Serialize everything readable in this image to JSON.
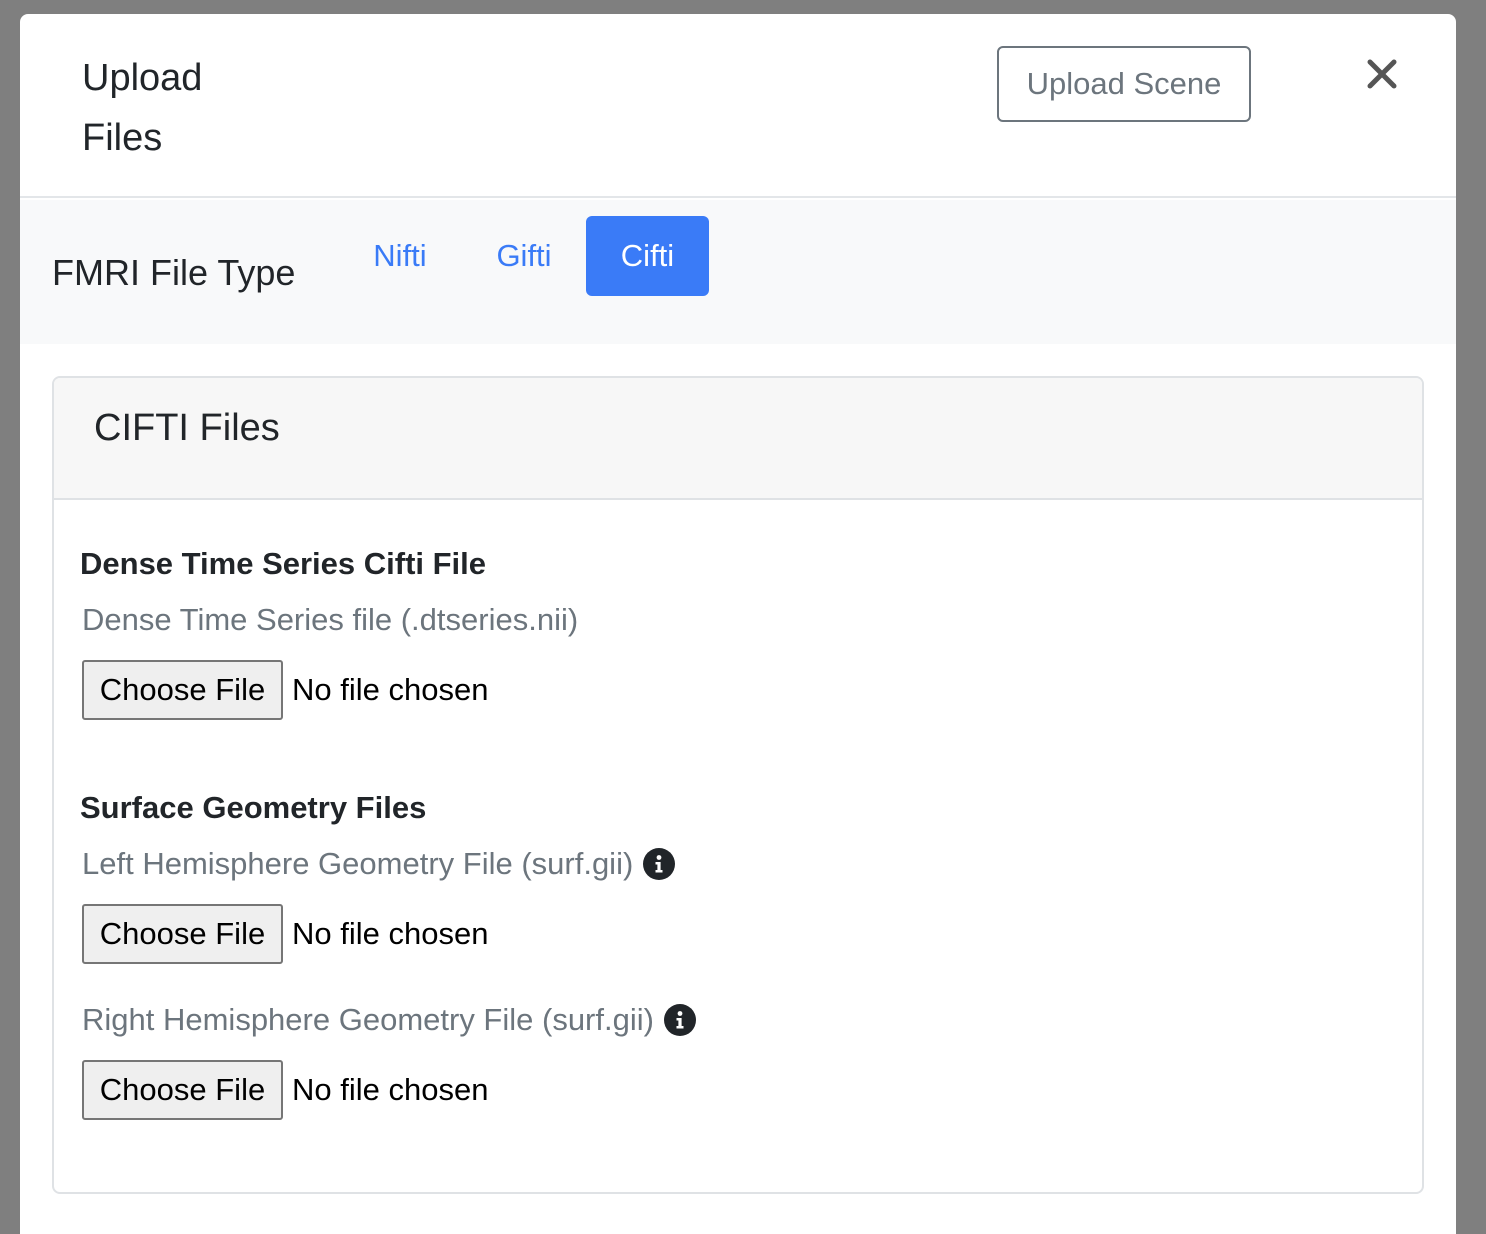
{
  "modal": {
    "title": "Upload Files",
    "upload_scene_label": "Upload Scene",
    "close_icon": "close-icon"
  },
  "navbar": {
    "label": "FMRI File Type",
    "tabs": [
      {
        "label": "Nifti",
        "active": false
      },
      {
        "label": "Gifti",
        "active": false
      },
      {
        "label": "Cifti",
        "active": true
      }
    ]
  },
  "card": {
    "title": "CIFTI Files",
    "sections": [
      {
        "heading": "Dense Time Series Cifti File",
        "fields": [
          {
            "label": "Dense Time Series file (.dtseries.nii)",
            "has_info": false,
            "button": "Choose File",
            "status": "No file chosen"
          }
        ]
      },
      {
        "heading": "Surface Geometry Files",
        "fields": [
          {
            "label": "Left Hemisphere Geometry File (surf.gii)",
            "has_info": true,
            "button": "Choose File",
            "status": "No file chosen"
          },
          {
            "label": "Right Hemisphere Geometry File (surf.gii)",
            "has_info": true,
            "button": "Choose File",
            "status": "No file chosen"
          }
        ]
      }
    ]
  },
  "colors": {
    "primary": "#3a7bf7",
    "secondary": "#6c757d",
    "backdrop": "#7f7f7f",
    "navbar_bg": "#f8f9fa"
  }
}
